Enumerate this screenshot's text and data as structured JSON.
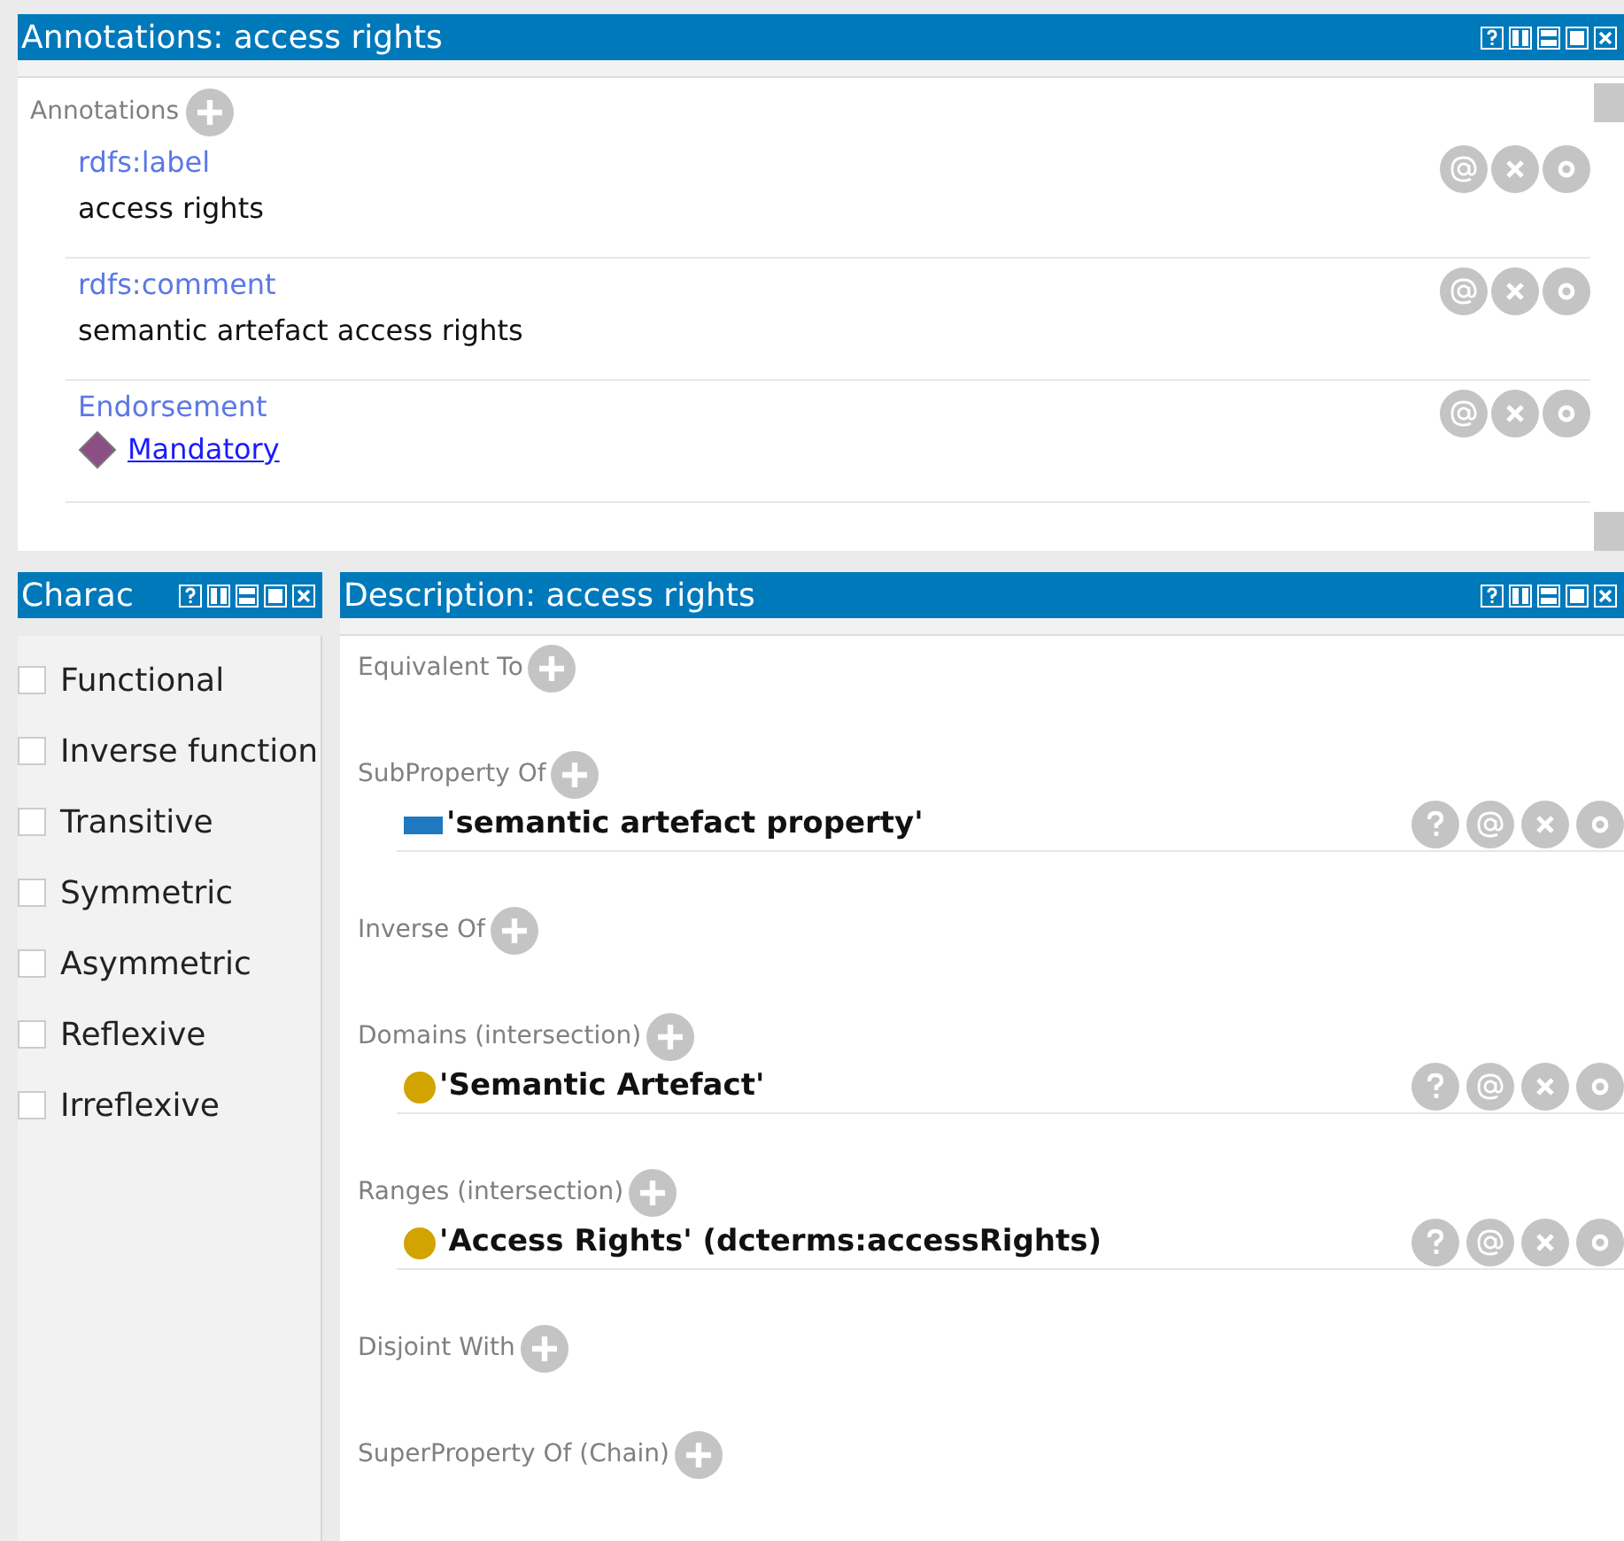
{
  "annotations_view": {
    "title": "Annotations: access rights",
    "header": "Annotations",
    "items": [
      {
        "property": "rdfs:label",
        "value": "access rights",
        "kind": "literal"
      },
      {
        "property": "rdfs:comment",
        "value": "semantic artefact access rights",
        "kind": "literal"
      },
      {
        "property": "Endorsement",
        "value": "Mandatory",
        "kind": "individual"
      }
    ]
  },
  "characteristics_view": {
    "title": "Charac",
    "items": [
      {
        "label": "Functional",
        "checked": false
      },
      {
        "label": "Inverse function",
        "checked": false
      },
      {
        "label": "Transitive",
        "checked": false
      },
      {
        "label": "Symmetric",
        "checked": false
      },
      {
        "label": "Asymmetric",
        "checked": false
      },
      {
        "label": "Reflexive",
        "checked": false
      },
      {
        "label": "Irreflexive",
        "checked": false
      }
    ]
  },
  "description_view": {
    "title": "Description: access rights",
    "sections": [
      {
        "header": "Equivalent To"
      },
      {
        "header": "SubProperty Of",
        "entries": [
          {
            "text": "'semantic artefact property'",
            "kind": "property"
          }
        ]
      },
      {
        "header": "Inverse Of"
      },
      {
        "header": "Domains (intersection)",
        "entries": [
          {
            "text": "'Semantic Artefact'",
            "kind": "class"
          }
        ]
      },
      {
        "header": "Ranges (intersection)",
        "entries": [
          {
            "text": "'Access Rights' (dcterms:accessRights)",
            "kind": "class"
          }
        ]
      },
      {
        "header": "Disjoint With"
      },
      {
        "header": "SuperProperty Of (Chain)"
      }
    ]
  }
}
